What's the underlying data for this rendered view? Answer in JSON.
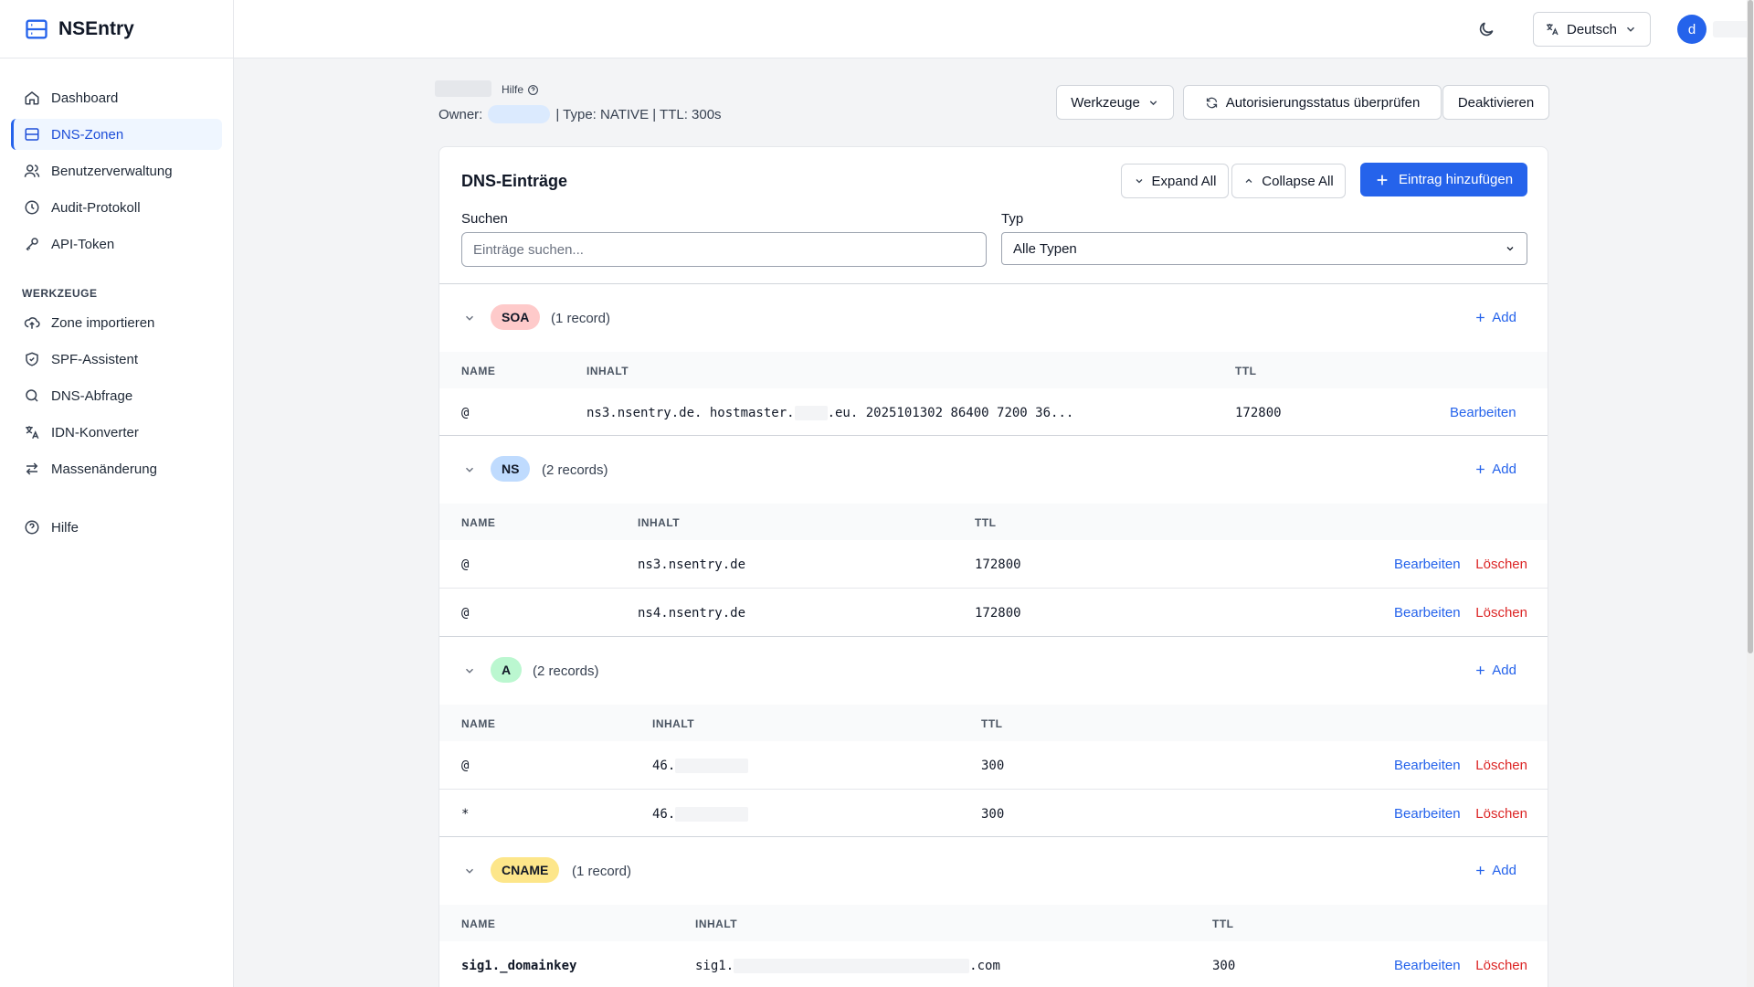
{
  "app": {
    "name": "NSEntry"
  },
  "sidebar": {
    "items": [
      {
        "label": "Dashboard",
        "icon": "home-icon"
      },
      {
        "label": "DNS-Zonen",
        "icon": "server-icon",
        "active": true
      },
      {
        "label": "Benutzerverwaltung",
        "icon": "users-icon"
      },
      {
        "label": "Audit-Protokoll",
        "icon": "clock-icon"
      },
      {
        "label": "API-Token",
        "icon": "key-icon"
      }
    ],
    "tools_heading": "WERKZEUGE",
    "tools": [
      {
        "label": "Zone importieren",
        "icon": "upload-cloud-icon"
      },
      {
        "label": "SPF-Assistent",
        "icon": "shield-icon"
      },
      {
        "label": "DNS-Abfrage",
        "icon": "search-icon"
      },
      {
        "label": "IDN-Konverter",
        "icon": "translate-icon"
      },
      {
        "label": "Massenänderung",
        "icon": "arrows-swap-icon"
      }
    ],
    "help": {
      "label": "Hilfe",
      "icon": "help-circle-icon"
    }
  },
  "header": {
    "language": "Deutsch",
    "avatar_letter": "d"
  },
  "zone": {
    "help_label": "Hilfe",
    "owner_label": "Owner:",
    "meta": "| Type: NATIVE | TTL: 300s",
    "actions": {
      "tools": "Werkzeuge",
      "check_auth": "Autorisierungsstatus überprüfen",
      "deactivate": "Deaktivieren"
    }
  },
  "records_card": {
    "title": "DNS-Einträge",
    "expand_all": "Expand All",
    "collapse_all": "Collapse All",
    "add_entry": "Eintrag hinzufügen",
    "search_label": "Suchen",
    "search_placeholder": "Einträge suchen...",
    "type_label": "Typ",
    "type_value": "Alle Typen",
    "col_name": "NAME",
    "col_content": "INHALT",
    "col_ttl": "TTL",
    "add_label": "Add",
    "edit_label": "Bearbeiten",
    "delete_label": "Löschen",
    "groups": [
      {
        "type": "SOA",
        "count": "(1 record)",
        "color": "#fecaca",
        "records": [
          {
            "name": "@",
            "content_a": "ns3.nsentry.de. hostmaster.",
            "content_b": ".eu. 2025101302 86400 7200 36...",
            "ttl": "172800"
          }
        ]
      },
      {
        "type": "NS",
        "count": "(2 records)",
        "color": "#bfdbfe",
        "records": [
          {
            "name": "@",
            "content": "ns3.nsentry.de",
            "ttl": "172800"
          },
          {
            "name": "@",
            "content": "ns4.nsentry.de",
            "ttl": "172800"
          }
        ]
      },
      {
        "type": "A",
        "count": "(2 records)",
        "color": "#bbf7d0",
        "records": [
          {
            "name": "@",
            "content": "46.",
            "ttl": "300"
          },
          {
            "name": "*",
            "content": "46.",
            "ttl": "300"
          }
        ]
      },
      {
        "type": "CNAME",
        "count": "(1 record)",
        "color": "#fde68a",
        "records": [
          {
            "name": "sig1._domainkey",
            "content_a": "sig1.",
            "content_b": ".com",
            "ttl": "300"
          }
        ]
      }
    ]
  }
}
